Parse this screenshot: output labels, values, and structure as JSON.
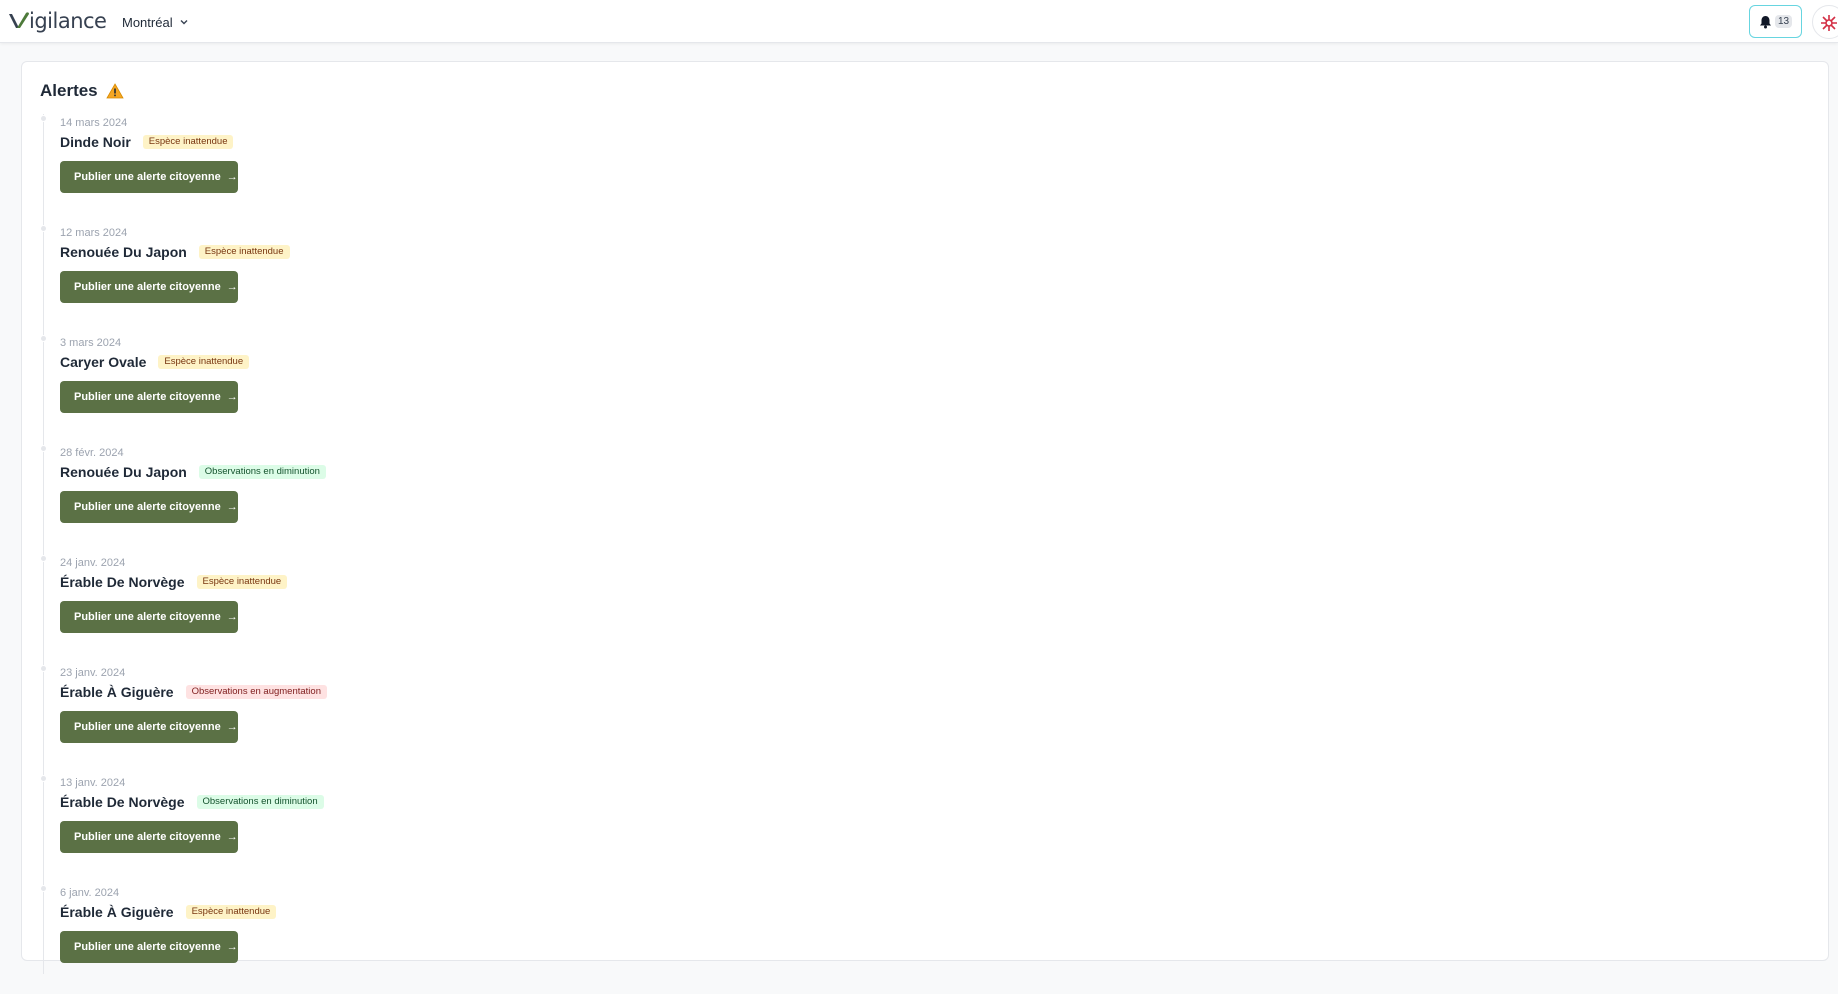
{
  "header": {
    "logo_text": "igilance",
    "city": "Montréal",
    "notification_count": "13"
  },
  "alerts_section": {
    "title": "Alertes",
    "publish_label": "Publier une alerte citoyenne",
    "publish_arrow": "→",
    "items": [
      {
        "date": "14 mars 2024",
        "species": "Dinde Noir",
        "badge": "Espèce inattendue",
        "badge_type": "yellow"
      },
      {
        "date": "12 mars 2024",
        "species": "Renouée Du Japon",
        "badge": "Espèce inattendue",
        "badge_type": "yellow"
      },
      {
        "date": "3 mars 2024",
        "species": "Caryer Ovale",
        "badge": "Espèce inattendue",
        "badge_type": "yellow"
      },
      {
        "date": "28 févr. 2024",
        "species": "Renouée Du Japon",
        "badge": "Observations en diminution",
        "badge_type": "green"
      },
      {
        "date": "24 janv. 2024",
        "species": "Érable De Norvège",
        "badge": "Espèce inattendue",
        "badge_type": "yellow"
      },
      {
        "date": "23 janv. 2024",
        "species": "Érable À Giguère",
        "badge": "Observations en augmentation",
        "badge_type": "red"
      },
      {
        "date": "13 janv. 2024",
        "species": "Érable De Norvège",
        "badge": "Observations en diminution",
        "badge_type": "green"
      },
      {
        "date": "6 janv. 2024",
        "species": "Érable À Giguère",
        "badge": "Espèce inattendue",
        "badge_type": "yellow"
      }
    ]
  },
  "colors": {
    "primary_button": "#5b7145",
    "notification_border": "#67d5e0",
    "badge_yellow": "#fef3c7",
    "badge_green": "#dcfce7",
    "badge_red": "#fee2e2"
  }
}
